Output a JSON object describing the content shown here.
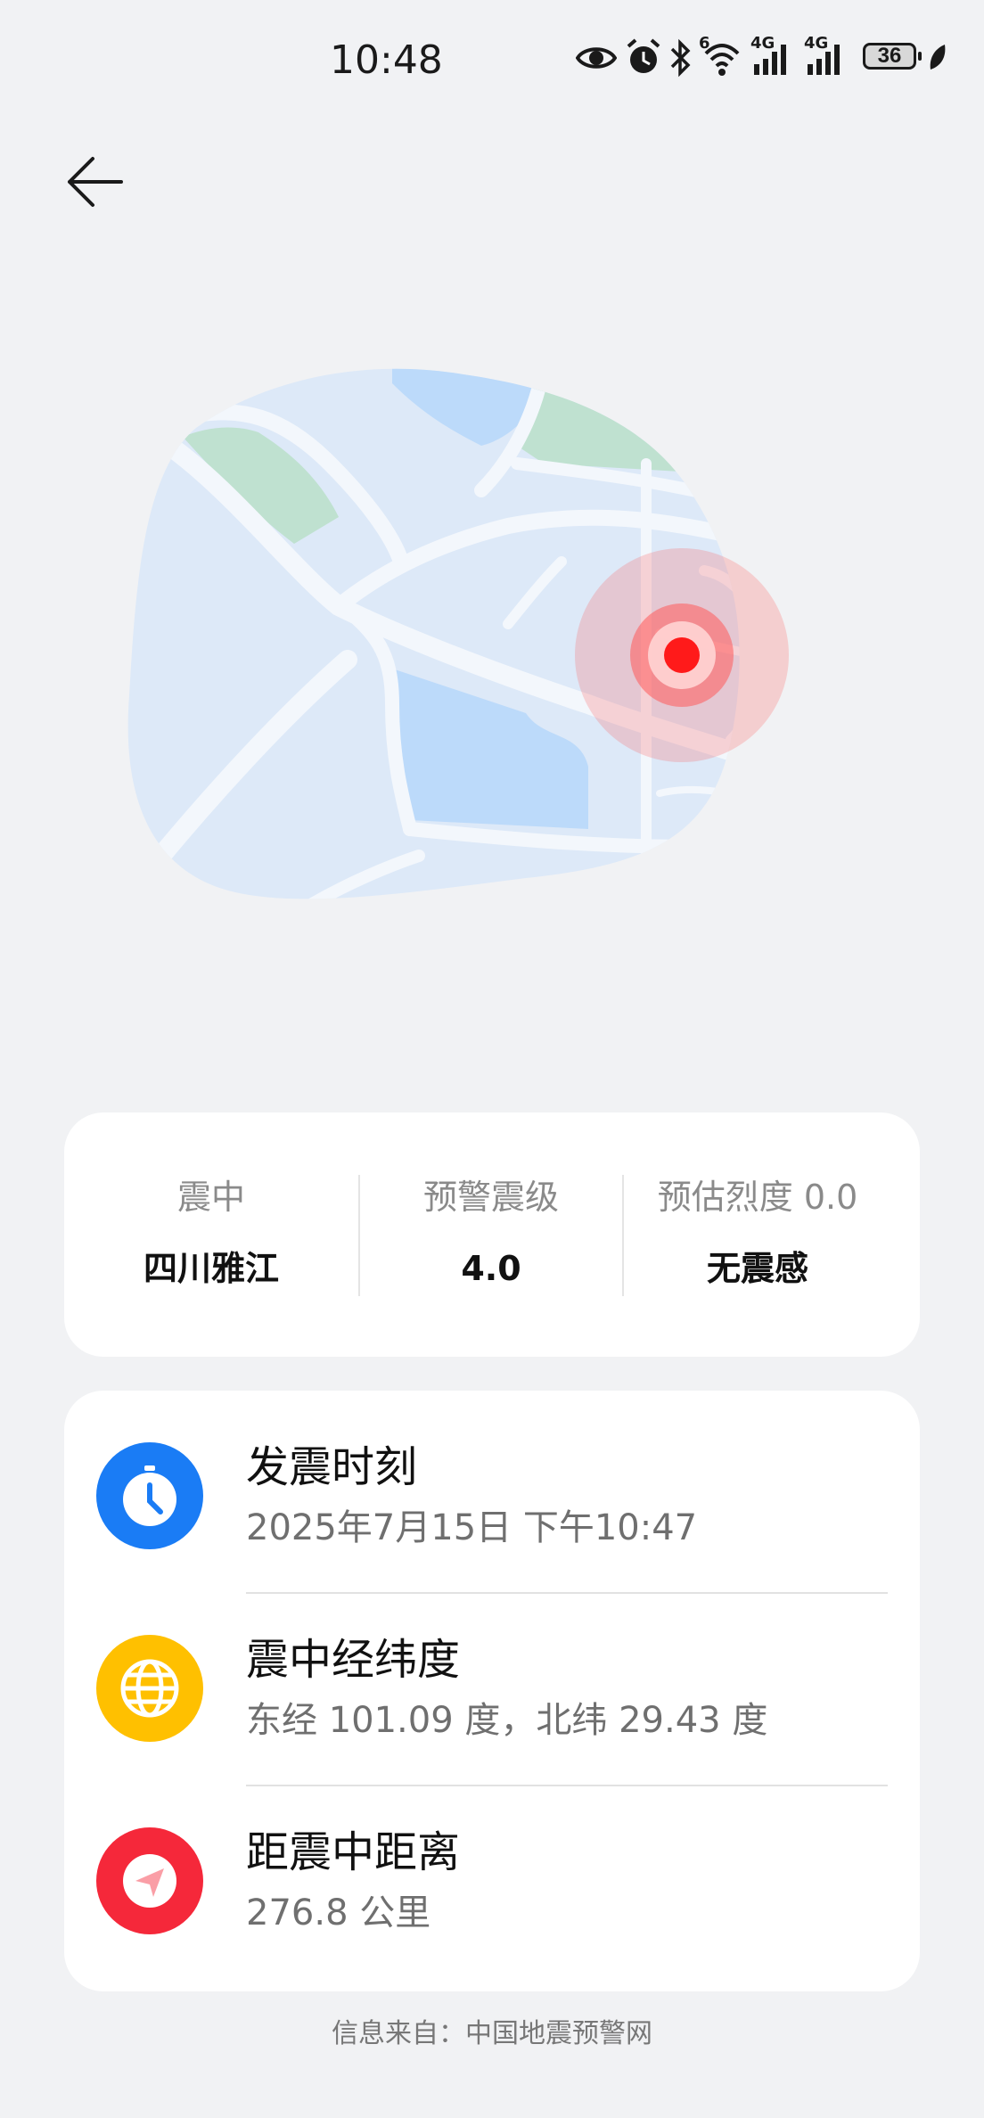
{
  "status_bar": {
    "time": "10:48",
    "battery": "36",
    "network_1": "4G",
    "network_2": "4G",
    "wifi_badge": "6",
    "icons": [
      "eye-icon",
      "alarm-icon",
      "bluetooth-icon",
      "wifi-icon",
      "signal-icon",
      "signal-icon",
      "battery-icon",
      "leaf-icon"
    ]
  },
  "nav": {
    "back_icon": "arrow-left-icon"
  },
  "summary": {
    "epicenter_label": "震中",
    "epicenter_value": "四川雅江",
    "magnitude_label": "预警震级",
    "magnitude_value": "4.0",
    "intensity_label": "预估烈度 0.0",
    "intensity_value": "无震感"
  },
  "details": [
    {
      "icon": "clock-icon",
      "color": "#1a7cf5",
      "title": "发震时刻",
      "value": "2025年7月15日 下午10:47"
    },
    {
      "icon": "globe-icon",
      "color": "#ffc000",
      "title": "震中经纬度",
      "value": "东经 101.09 度，北纬 29.43 度"
    },
    {
      "icon": "navigation-icon",
      "color": "#f5283a",
      "title": "距震中距离",
      "value": "276.8 公里"
    }
  ],
  "footer": "信息来自：中国地震预警网",
  "colors": {
    "background": "#f1f2f4",
    "map_land": "#dde9f8",
    "map_water": "#bcdafa",
    "map_park": "#bfe1d0",
    "epicenter": "#ff1a1a"
  }
}
